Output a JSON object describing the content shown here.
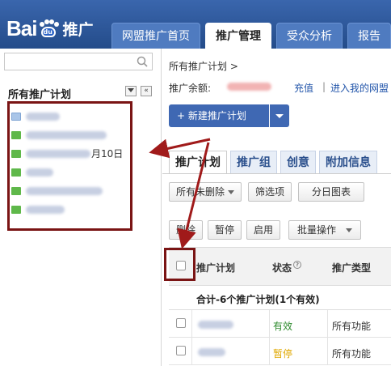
{
  "logo": {
    "bai": "Bai",
    "du": "du",
    "sub": "推广"
  },
  "top_tabs": [
    "网盟推广首页",
    "推广管理",
    "受众分析",
    "报告"
  ],
  "left": {
    "title": "所有推广计划",
    "collapse_symbol": "«",
    "tree_items": [
      {
        "color": "#a9c5e8"
      },
      {
        "color": "#5fb84a"
      },
      {
        "color": "#5fb84a",
        "suffix": "月10日"
      },
      {
        "color": "#5fb84a"
      },
      {
        "color": "#5fb84a"
      },
      {
        "color": "#5fb84a"
      }
    ]
  },
  "right": {
    "breadcrumb": "所有推广计划 >",
    "balance_label": "推广余额:",
    "recharge": "充值",
    "separator": "|",
    "enter_link": "进入我的网盟",
    "new_plan_button": "+ 新建推广计划",
    "sub_tabs": [
      "推广计划",
      "推广组",
      "创意",
      "附加信息"
    ],
    "filter_select": "所有未删除",
    "filter_button": "筛选项",
    "daily_chart_button": "分日图表",
    "toolbar": {
      "delete": "删除",
      "pause": "暂停",
      "enable": "启用",
      "batch": "批量操作"
    },
    "table": {
      "headers": [
        "推广计划",
        "状态",
        "推广类型"
      ],
      "help_symbol": "?",
      "summary": "合计-6个推广计划(1个有效)",
      "rows": [
        {
          "status": "有效",
          "status_color": "#2e8b2e",
          "type": "所有功能"
        },
        {
          "status": "暂停",
          "status_color": "#e0a800",
          "type": "所有功能"
        }
      ]
    }
  },
  "colors": {
    "topbar": "#2a4f8c",
    "annotation": "#7a1414",
    "link": "#2255aa"
  }
}
